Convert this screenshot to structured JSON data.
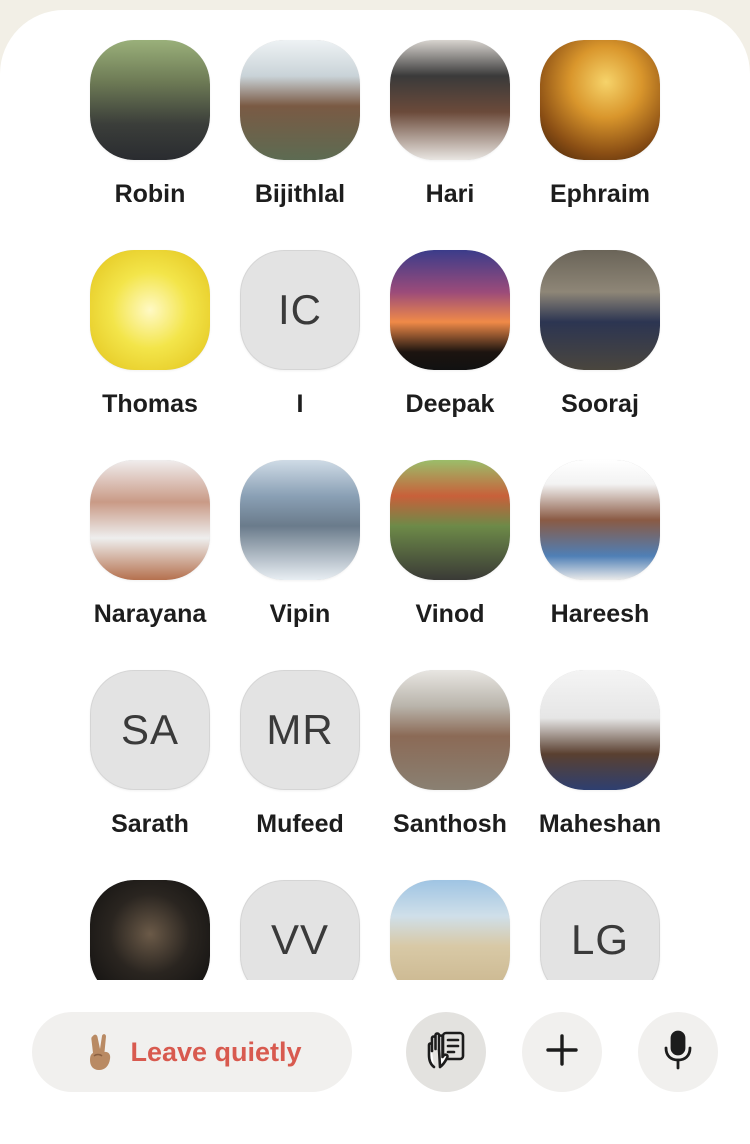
{
  "members": [
    {
      "name": "Robin",
      "type": "photo",
      "bg": "linear-gradient(180deg,#9ab07a 0%,#6d7a55 35%,#3b3e3a 70%,#2a2c30 100%)"
    },
    {
      "name": "Bijithlal",
      "type": "photo",
      "bg": "linear-gradient(180deg,#eef2f4 0%,#c9d3d8 30%,#7a5a44 55%,#5d6b52 100%)"
    },
    {
      "name": "Hari",
      "type": "photo",
      "bg": "linear-gradient(180deg,#d8d4cf 0%,#3a3a3a 30%,#6b4a3a 60%,#e9e6e2 100%)"
    },
    {
      "name": "Ephraim",
      "type": "photo",
      "bg": "radial-gradient(circle at 55% 35%,#f6d36a 0%,#d9962c 35%,#8a4e14 70%,#3a1f08 100%)"
    },
    {
      "name": "Thomas",
      "type": "photo",
      "bg": "radial-gradient(circle at 50% 50%,#fff9c4 0%,#f3e54a 45%,#e2c21a 100%)"
    },
    {
      "name": "I",
      "type": "initials",
      "initials": "IC"
    },
    {
      "name": "Deepak",
      "type": "photo",
      "bg": "linear-gradient(180deg,#3b3c8a 0%,#9b4b7a 35%,#f08a48 60%,#1c1410 85%,#111 100%)"
    },
    {
      "name": "Sooraj",
      "type": "photo",
      "bg": "linear-gradient(180deg,#6a6458 0%,#8e8677 35%,#2c3552 60%,#4a463e 100%)"
    },
    {
      "name": "Narayana",
      "type": "photo",
      "bg": "linear-gradient(180deg,#f0eded 0%,#c99a86 35%,#eeeeee 65%,#b5704e 100%)"
    },
    {
      "name": "Vipin",
      "type": "photo",
      "bg": "linear-gradient(180deg,#cfdbe6 0%,#8aa0b5 30%,#6a7b8b 55%,#e8eef3 100%)"
    },
    {
      "name": "Vinod",
      "type": "photo",
      "bg": "linear-gradient(180deg,#9bbd6a 0%,#c8603a 30%,#6d8a48 55%,#3a3a36 100%)"
    },
    {
      "name": "Hareesh",
      "type": "photo",
      "bg": "linear-gradient(180deg,#ffffff 0%,#f3f3f3 20%,#8a5a44 50%,#4f7fb6 80%,#eaeaea 100%)"
    },
    {
      "name": "Sarath",
      "type": "initials",
      "initials": "SA"
    },
    {
      "name": "Mufeed",
      "type": "initials",
      "initials": "MR"
    },
    {
      "name": "Santhosh",
      "type": "photo",
      "bg": "linear-gradient(180deg,#e8e6e2 0%,#b9b4ab 30%,#8b6a56 55%,#8a8072 100%)"
    },
    {
      "name": "Maheshan",
      "type": "photo",
      "bg": "linear-gradient(180deg,#f4f4f4 0%,#e6e6e6 40%,#5a4030 70%,#2e3f70 100%)"
    },
    {
      "name": "",
      "type": "photo",
      "bg": "radial-gradient(circle at 50% 45%,#6b5a48 0%,#2a2520 45%,#0d0d0d 100%)"
    },
    {
      "name": "",
      "type": "initials",
      "initials": "VV"
    },
    {
      "name": "",
      "type": "photo",
      "bg": "linear-gradient(180deg,#9fc4e3 0%,#cfdfe9 30%,#d8c9a6 55%,#c8b38a 100%)"
    },
    {
      "name": "",
      "type": "initials",
      "initials": "LG"
    }
  ],
  "toolbar": {
    "leave_label": "Leave quietly",
    "leave_emoji": "victory-hand-emoji",
    "raise_hand_icon": "raise-hand-icon",
    "add_icon": "plus-icon",
    "mic_icon": "microphone-icon"
  }
}
